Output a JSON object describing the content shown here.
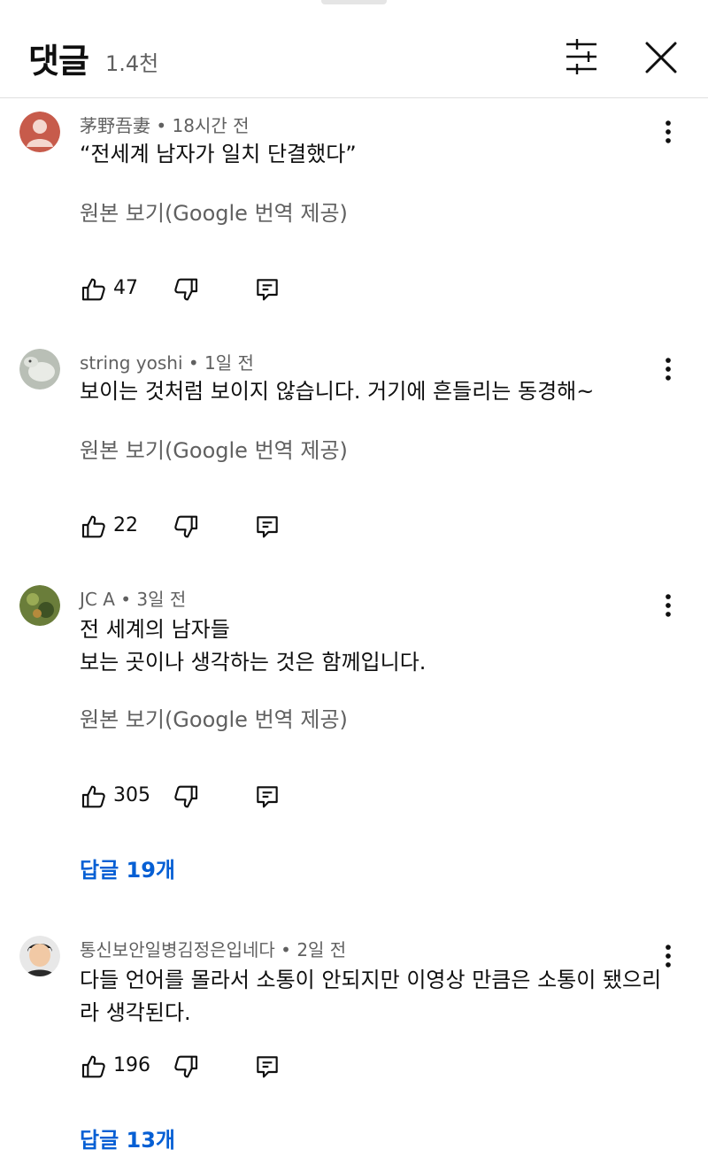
{
  "header": {
    "title": "댓글",
    "count": "1.4천"
  },
  "colors": {
    "link": "#065fd4",
    "secondary_text": "#606060"
  },
  "comments": [
    {
      "author": "茅野吾妻",
      "time": "18시간 전",
      "text": "“전세계 남자가 일치 단결했다”",
      "translate_label": "원본 보기(Google 번역 제공)",
      "likes": "47"
    },
    {
      "author": "string yoshi",
      "time": "1일 전",
      "text": "보이는 것처럼 보이지 않습니다. 거기에 흔들리는 동경해~",
      "translate_label": "원본 보기(Google 번역 제공)",
      "likes": "22"
    },
    {
      "author": "JC A",
      "time": "3일 전",
      "text": "전 세계의 남자들\n보는 곳이나 생각하는 것은 함께입니다.",
      "translate_label": "원본 보기(Google 번역 제공)",
      "likes": "305",
      "replies": "답글 19개"
    },
    {
      "author": "통신보안일병김정은입네다",
      "time": "2일 전",
      "text": "다들 언어를 몰라서 소통이 안되지만 이영상 만큼은 소통이 됐으리라 생각된다.",
      "likes": "196",
      "replies": "답글 13개"
    }
  ],
  "meta_separator": "•",
  "icons": [
    "filter-icon",
    "close-icon",
    "more-vert-icon",
    "thumb-up-icon",
    "thumb-down-icon",
    "reply-icon"
  ]
}
